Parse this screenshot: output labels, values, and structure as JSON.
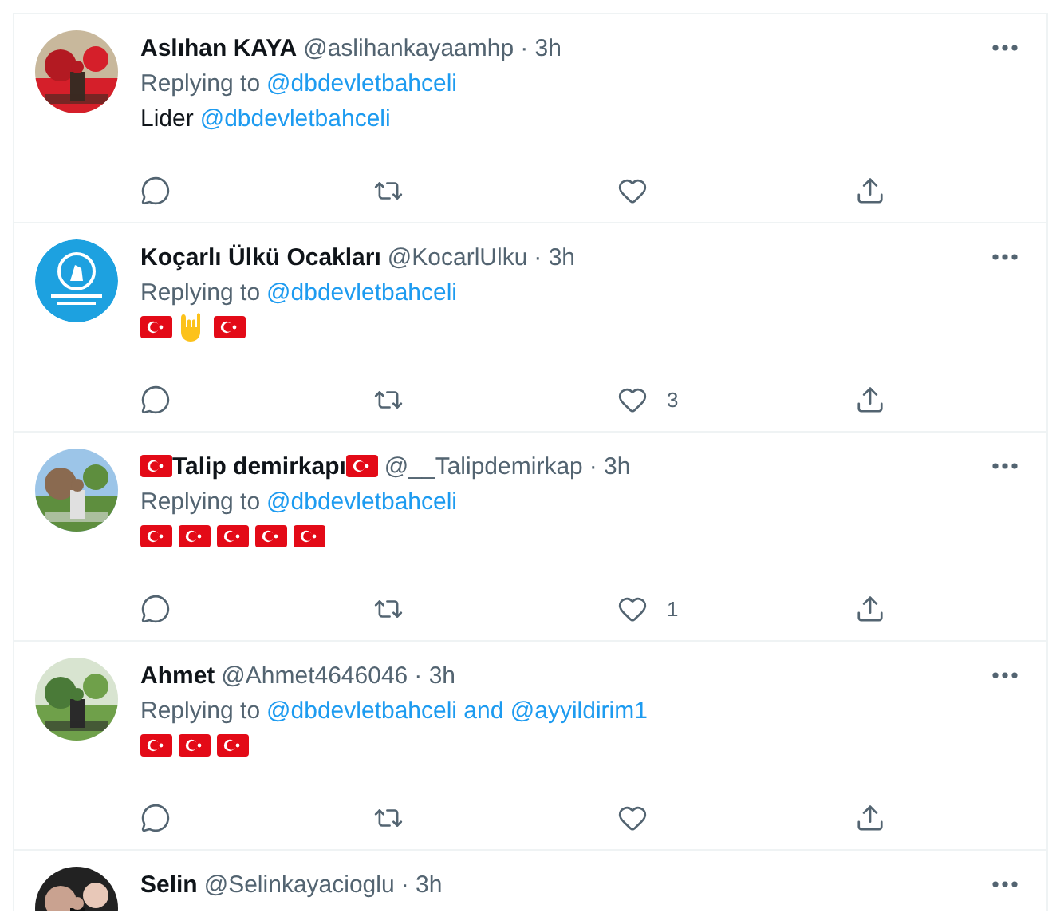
{
  "tweets": [
    {
      "name": [
        {
          "kind": "text",
          "text": "Aslıhan KAYA"
        }
      ],
      "handle": "@aslihankayaamhp",
      "time": "· 3h",
      "reply_prefix": "Replying to",
      "reply_target": "@dbdevletbahceli",
      "body": [
        {
          "kind": "text",
          "text": "Lider"
        },
        {
          "kind": "mention",
          "text": "@dbdevletbahceli"
        }
      ],
      "actions": [
        {
          "kind": "reply"
        },
        {
          "kind": "retweet"
        },
        {
          "kind": "like"
        },
        {
          "kind": "share"
        }
      ]
    },
    {
      "name": [
        {
          "kind": "text",
          "text": "Koçarlı Ülkü Ocakları"
        }
      ],
      "handle": "@KocarlUlku",
      "time": "· 3h",
      "reply_prefix": "Replying to",
      "reply_target": "@dbdevletbahceli",
      "body": [
        {
          "kind": "flag"
        },
        {
          "kind": "hand"
        },
        {
          "kind": "flag"
        }
      ],
      "actions": [
        {
          "kind": "reply"
        },
        {
          "kind": "retweet"
        },
        {
          "kind": "like",
          "count": "3"
        },
        {
          "kind": "share"
        }
      ]
    },
    {
      "name": [
        {
          "kind": "flag"
        },
        {
          "kind": "text",
          "text": "Talip demirkapı"
        },
        {
          "kind": "flag"
        }
      ],
      "handle": "@__Talipdemirkap",
      "time": "· 3h",
      "reply_prefix": "Replying to",
      "reply_target": "@dbdevletbahceli",
      "body": [
        {
          "kind": "flag"
        },
        {
          "kind": "flag"
        },
        {
          "kind": "flag"
        },
        {
          "kind": "flag"
        },
        {
          "kind": "flag"
        }
      ],
      "actions": [
        {
          "kind": "reply"
        },
        {
          "kind": "retweet"
        },
        {
          "kind": "like",
          "count": "1"
        },
        {
          "kind": "share"
        }
      ]
    },
    {
      "name": [
        {
          "kind": "text",
          "text": "Ahmet"
        }
      ],
      "handle": "@Ahmet4646046",
      "time": "· 3h",
      "reply_prefix": "Replying to",
      "reply_target": "@dbdevletbahceli and @ayyildirim1",
      "body": [
        {
          "kind": "flag"
        },
        {
          "kind": "flag"
        },
        {
          "kind": "flag"
        }
      ],
      "actions": [
        {
          "kind": "reply"
        },
        {
          "kind": "retweet"
        },
        {
          "kind": "like"
        },
        {
          "kind": "share"
        }
      ]
    },
    {
      "name": [
        {
          "kind": "text",
          "text": "Selin"
        }
      ],
      "handle": "@Selinkayacioglu",
      "time": "· 3h"
    }
  ]
}
